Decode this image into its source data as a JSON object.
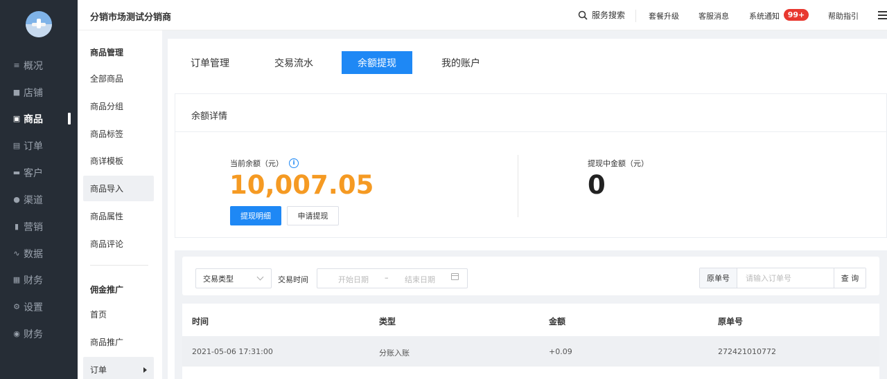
{
  "header": {
    "shop_title": "分销市场测试分销商",
    "search_label": "服务搜索",
    "links": [
      "套餐升级",
      "客服消息",
      "系统通知",
      "帮助指引"
    ],
    "notify_badge": "99+"
  },
  "nav": {
    "items": [
      {
        "label": "概况",
        "icon": "list-icon"
      },
      {
        "label": "店铺",
        "icon": "shop-icon"
      },
      {
        "label": "商品",
        "icon": "goods-icon"
      },
      {
        "label": "订单",
        "icon": "order-icon"
      },
      {
        "label": "客户",
        "icon": "customer-icon"
      },
      {
        "label": "渠道",
        "icon": "channel-icon"
      },
      {
        "label": "营销",
        "icon": "marketing-icon"
      },
      {
        "label": "数据",
        "icon": "data-icon"
      },
      {
        "label": "财务",
        "icon": "finance-icon"
      },
      {
        "label": "设置",
        "icon": "settings-icon"
      },
      {
        "label": "财务",
        "icon": "finance2-icon"
      }
    ],
    "active_index": 2
  },
  "sidebar": {
    "section1_title": "商品管理",
    "section1_items": [
      "全部商品",
      "商品分组",
      "商品标签",
      "商详模板",
      "商品导入",
      "商品属性",
      "商品评论"
    ],
    "section2_title": "佣金推广",
    "section2_items": [
      "首页",
      "商品推广",
      "订单"
    ]
  },
  "tabs": [
    "订单管理",
    "交易流水",
    "余额提现",
    "我的账户"
  ],
  "active_tab": 2,
  "balance": {
    "section_title": "余额详情",
    "current_label": "当前余额（元）",
    "current_amount": "10,007.05",
    "detail_button": "提现明细",
    "apply_button": "申请提现",
    "withdrawing_label": "提现中金额（元）",
    "withdrawing_amount": "0"
  },
  "filter": {
    "type_select": "交易类型",
    "time_label": "交易时间",
    "start_placeholder": "开始日期",
    "date_sep": "–",
    "end_placeholder": "结束日期",
    "order_label": "原单号",
    "order_placeholder": "请输入订单号",
    "query_button": "查 询"
  },
  "table": {
    "headers": [
      "时间",
      "类型",
      "金额",
      "原单号"
    ],
    "rows": [
      [
        "2021-05-06 17:31:00",
        "分账入账",
        "+0.09",
        "272421010772"
      ]
    ]
  },
  "colors": {
    "primary": "#1e88f5",
    "balance": "#f59a23",
    "badge": "#e8382f",
    "nav_bg": "#262d36"
  }
}
